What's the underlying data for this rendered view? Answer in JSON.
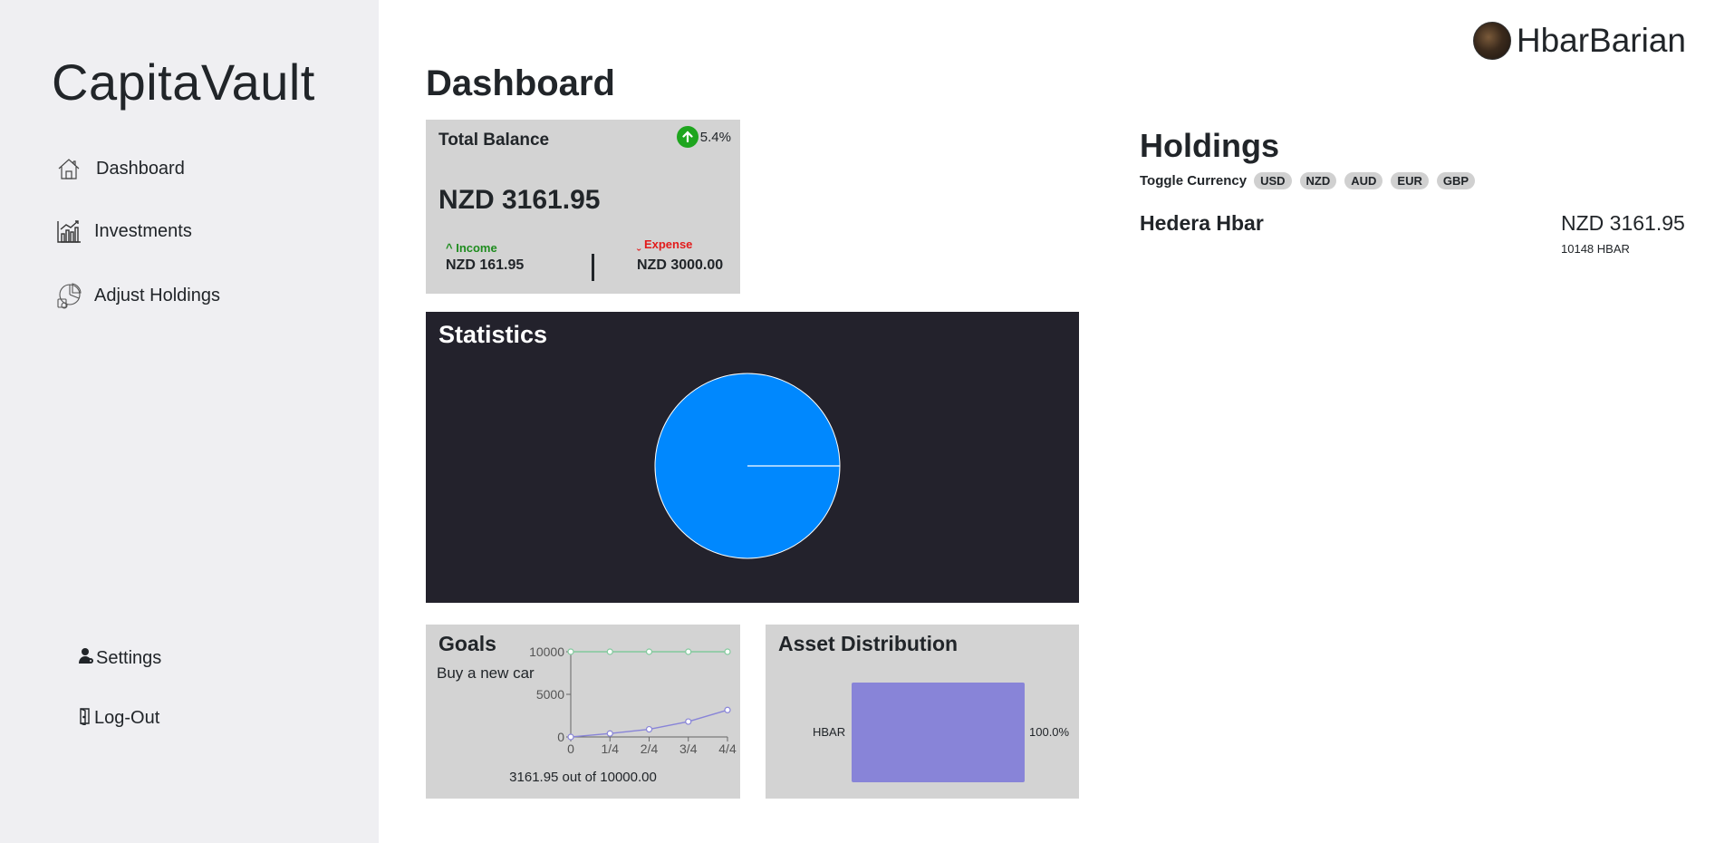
{
  "sidebar": {
    "brand": "CapitaVault",
    "items": [
      {
        "label": "Dashboard",
        "icon": "home-icon"
      },
      {
        "label": "Investments",
        "icon": "chart-icon"
      },
      {
        "label": "Adjust Holdings",
        "icon": "pie-chart-icon"
      }
    ],
    "footer": [
      {
        "label": "Settings",
        "icon": "user-gear-icon"
      },
      {
        "label": "Log-Out",
        "icon": "door-icon"
      }
    ]
  },
  "header": {
    "username": "HbarBarian",
    "page_title": "Dashboard"
  },
  "balance": {
    "title": "Total Balance",
    "change": "5.4%",
    "amount": "NZD 3161.95",
    "income_label": "^ Income",
    "income_value": "NZD 161.95",
    "expense_label": "ˬ Expense",
    "expense_value": "NZD 3000.00"
  },
  "statistics": {
    "title": "Statistics",
    "color": "#0088fe"
  },
  "goals": {
    "title": "Goals",
    "goal_name": "Buy a new car",
    "progress_text": "3161.95 out of 10000.00"
  },
  "asset_distribution": {
    "title": "Asset Distribution",
    "bar_color": "#8884d8"
  },
  "holdings": {
    "title": "Holdings",
    "toggle_label": "Toggle Currency",
    "currencies": [
      "USD",
      "NZD",
      "AUD",
      "EUR",
      "GBP"
    ],
    "items": [
      {
        "name": "Hedera Hbar",
        "value": "NZD 3161.95",
        "units": "10148 HBAR"
      }
    ]
  },
  "chart_data": [
    {
      "type": "pie",
      "title": "Statistics",
      "categories": [
        "HBAR"
      ],
      "values": [
        100
      ]
    },
    {
      "type": "line",
      "title": "Goals",
      "categories": [
        "0",
        "1/4",
        "2/4",
        "3/4",
        "4/4"
      ],
      "ylim": [
        0,
        10000
      ],
      "yticks": [
        0,
        5000,
        10000
      ],
      "series": [
        {
          "values": [
            10000,
            10000,
            10000,
            10000,
            10000
          ],
          "color": "#82ca9d"
        },
        {
          "values": [
            0,
            400,
            900,
            1800,
            3162
          ],
          "color": "#8884d8"
        }
      ]
    },
    {
      "type": "bar",
      "title": "Asset Distribution",
      "categories": [
        "HBAR"
      ],
      "values": [
        100.0
      ],
      "value_labels": [
        "100.0%"
      ]
    }
  ]
}
